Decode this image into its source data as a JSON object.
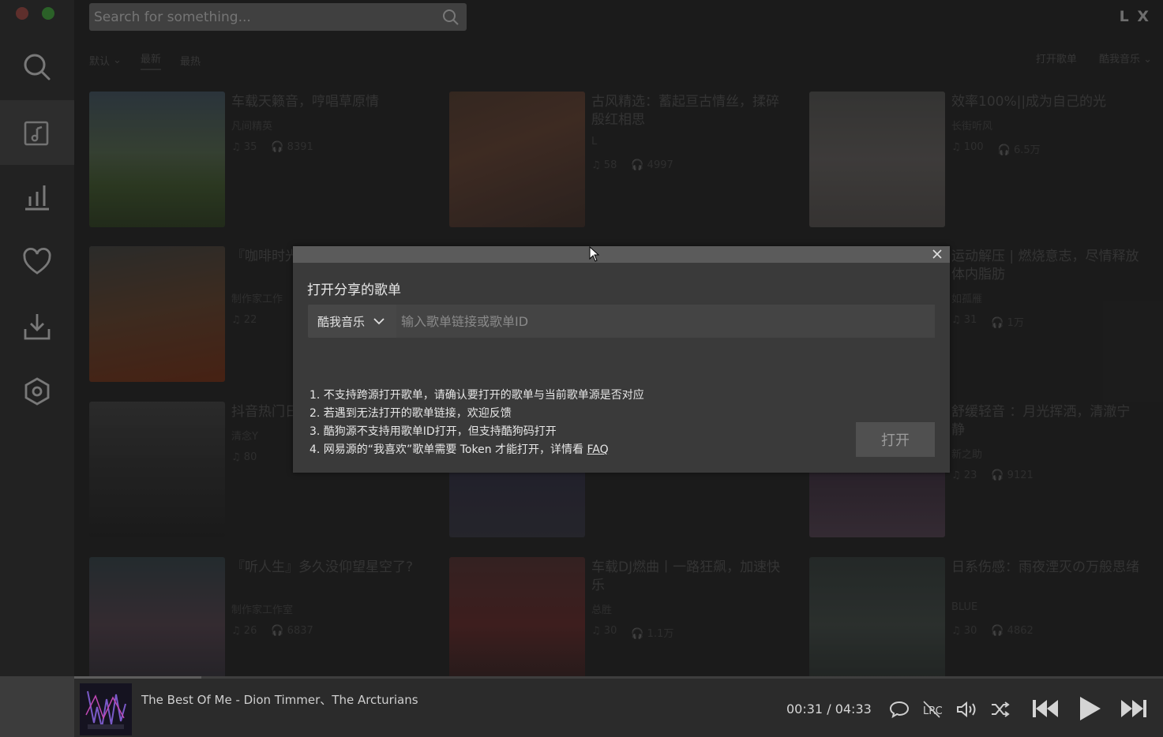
{
  "window": {
    "logo": "L X"
  },
  "search": {
    "placeholder": "Search for something..."
  },
  "sort_tabs": [
    {
      "label": "默认"
    },
    {
      "label": "最新"
    },
    {
      "label": "最热"
    }
  ],
  "header_actions": {
    "open_playlist": "打开歌单",
    "source": "酷我音乐"
  },
  "cards": [
    {
      "title": "车载天籁音，哼唱草原情",
      "author": "凡间精英",
      "songs": "35",
      "plays": "8391"
    },
    {
      "title": "古风精选：蓄起亘古情丝，揉碎殷红相思",
      "author": "L",
      "songs": "58",
      "plays": "4997"
    },
    {
      "title": "效率100%||成为自己的光",
      "author": "长街听风",
      "songs": "100",
      "plays": "6.5万"
    },
    {
      "title": "『咖啡时光』疗",
      "author": "制作家工作",
      "songs": "22",
      "plays": ""
    },
    {
      "title": "运动解压 | 燃烧意志，尽情释放体内脂肪",
      "author": "如孤雁",
      "songs": "31",
      "plays": "1万"
    },
    {
      "title": "抖音热门日",
      "author": "清念Y",
      "songs": "80",
      "plays": ""
    },
    {
      "title": "舒缓轻音 ：月光挥洒，清澈宁静",
      "author": "新之助",
      "songs": "23",
      "plays": "9121"
    },
    {
      "title": "『听人生』多久没仰望星空了?",
      "author": "制作家工作室",
      "songs": "26",
      "plays": "6837"
    },
    {
      "title": "车载DJ燃曲丨一路狂飙，加速快乐",
      "author": "总胜",
      "songs": "30",
      "plays": "1.1万"
    },
    {
      "title": "日系伤感：雨夜湮灭の万般思绪",
      "author": "BLUE",
      "songs": "30",
      "plays": "4862"
    }
  ],
  "modal": {
    "title": "打开分享的歌单",
    "source_select": "酷我音乐",
    "input_placeholder": "输入歌单链接或歌单ID",
    "tips": [
      "1. 不支持跨源打开歌单，请确认要打开的歌单与当前歌单源是否对应",
      "2. 若遇到无法打开的歌单链接，欢迎反馈",
      "3. 酷狗源不支持用歌单ID打开，但支持酷狗码打开",
      "4. 网易源的“我喜欢”歌单需要 Token 才能打开，详情看 "
    ],
    "faq_link": "FAQ",
    "open_button": "打开"
  },
  "player": {
    "track": "The Best Of Me - Dion Timmer、The Arcturians",
    "current_time": "00:31",
    "separator": "/",
    "total_time": "04:33",
    "progress": 0.117
  },
  "icons": {
    "sidebar": [
      "search-icon",
      "playlist-icon",
      "leaderboard-icon",
      "heart-icon",
      "download-icon",
      "settings-icon"
    ],
    "player": [
      "comment-icon",
      "lyrics-icon",
      "volume-icon",
      "shuffle-icon",
      "previous-icon",
      "play-icon",
      "next-icon"
    ]
  },
  "colors": {
    "sidebar": "#3c3c3c",
    "main": "#303030",
    "modal": "#3a3a3a",
    "traffic_red": "#a3524c",
    "traffic_green": "#4aa845"
  }
}
